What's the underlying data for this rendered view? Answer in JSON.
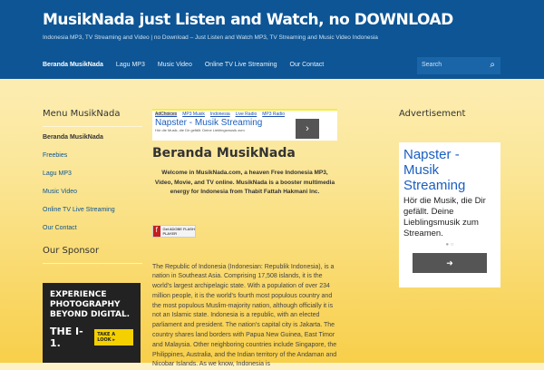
{
  "header": {
    "title": "MusikNada just Listen and Watch, no DOWNLOAD",
    "tagline": "Indonesia MP3, TV Streaming and Video | no Download – Just Listen and Watch MP3, TV Streaming and Music Video Indonesia"
  },
  "nav": [
    "Beranda MusikNada",
    "Lagu MP3",
    "Music Video",
    "Online TV Live Streaming",
    "Our Contact"
  ],
  "search": {
    "placeholder": "Search"
  },
  "left": {
    "menu_title": "Menu MusikNada",
    "items": [
      "Beranda MusikNada",
      "Freebies",
      "Lagu MP3",
      "Music Video",
      "Online TV Live Streaming",
      "Our Contact"
    ],
    "sponsor_title": "Our Sponsor",
    "sponsor_ad": {
      "line1": "EXPERIENCE",
      "line2": "PHOTOGRAPHY",
      "line3": "BEYOND DIGITAL.",
      "product": "THE I-1.",
      "cta": "TAKE A LOOK ▸"
    }
  },
  "main": {
    "ad": {
      "choices": "AdChoices",
      "links": [
        "MP3 Musik",
        "Indonesia",
        "Live Radio",
        "MP3 Radio"
      ],
      "title": "Napster - Musik Streaming",
      "sub": "Hör die Musik, die Dir gefällt. Deine Lieblingsmusik zum"
    },
    "title": "Beranda MusikNada",
    "welcome": "Welcome in MusikNada.com, a heaven Free Indonesia MP3, Video, Movie, and TV online. MusikNada is a booster multimedia energy for Indonesia from Thabit Fattah Hakmani Inc.",
    "flash": "Get ADOBE FLASH PLAYER",
    "body": "The Republic of Indonesia (Indonesian: Republik Indonesia), is a nation in Southeast Asia. Comprising 17,508 islands, it is the world's largest archipelagic state. With a population of over 234 million people, it is the world's fourth most populous country and the most populous Muslim-majority nation, although officially it is not an Islamic state. Indonesia is a republic, with an elected parliament and president. The nation's capital city is Jakarta. The country shares land borders with Papua New Guinea, East Timor and Malaysia. Other neighboring countries include Singapore, the Philippines, Australia, and the Indian territory of the Andaman and Nicobar Islands. As we know, Indonesia is"
  },
  "right": {
    "title": "Advertisement",
    "ad": {
      "title": "Napster - Musik Streaming",
      "sub": "Hör die Musik, die Dir gefällt. Deine Lieblingsmusik zum Streamen."
    }
  }
}
